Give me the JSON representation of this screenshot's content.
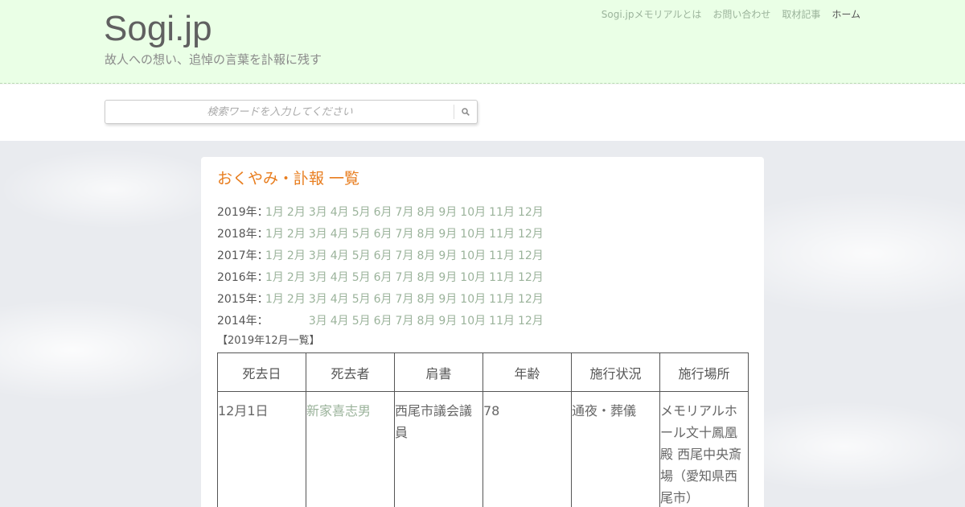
{
  "site": {
    "title": "Sogi.jp",
    "tagline": "故人への想い、追悼の言葉を訃報に残す"
  },
  "nav": {
    "items": [
      {
        "label": "Sogi.jpメモリアルとは"
      },
      {
        "label": "お問い合わせ"
      },
      {
        "label": "取材記事"
      },
      {
        "label": "ホーム",
        "current": true
      }
    ]
  },
  "search": {
    "placeholder": "検索ワードを入力してください",
    "icon": "search-icon"
  },
  "main": {
    "heading": "おくやみ・訃報 一覧",
    "archive": [
      {
        "year": "2019年：",
        "months": [
          "1月",
          "2月",
          "3月",
          "4月",
          "5月",
          "6月",
          "7月",
          "8月",
          "9月",
          "10月",
          "11月",
          "12月"
        ]
      },
      {
        "year": "2018年：",
        "months": [
          "1月",
          "2月",
          "3月",
          "4月",
          "5月",
          "6月",
          "7月",
          "8月",
          "9月",
          "10月",
          "11月",
          "12月"
        ]
      },
      {
        "year": "2017年：",
        "months": [
          "1月",
          "2月",
          "3月",
          "4月",
          "5月",
          "6月",
          "7月",
          "8月",
          "9月",
          "10月",
          "11月",
          "12月"
        ]
      },
      {
        "year": "2016年：",
        "months": [
          "1月",
          "2月",
          "3月",
          "4月",
          "5月",
          "6月",
          "7月",
          "8月",
          "9月",
          "10月",
          "11月",
          "12月"
        ]
      },
      {
        "year": "2015年：",
        "months": [
          "1月",
          "2月",
          "3月",
          "4月",
          "5月",
          "6月",
          "7月",
          "8月",
          "9月",
          "10月",
          "11月",
          "12月"
        ]
      },
      {
        "year": "2014年：",
        "months": [
          "",
          "",
          "3月",
          "4月",
          "5月",
          "6月",
          "7月",
          "8月",
          "9月",
          "10月",
          "11月",
          "12月"
        ]
      }
    ],
    "list_caption": "【2019年12月一覧】",
    "table": {
      "headers": [
        "死去日",
        "死去者",
        "肩書",
        "年齢",
        "施行状況",
        "施行場所"
      ],
      "rows": [
        [
          "12月1日",
          "新家喜志男",
          "西尾市議会議員",
          "78",
          "通夜・葬儀",
          "メモリアルホール文十鳳凰殿 西尾中央斎場（愛知県西尾市）"
        ]
      ]
    }
  },
  "colors": {
    "header_bg": "#eaffe6",
    "heading": "#e87d1e",
    "link": "#9bb39b"
  }
}
